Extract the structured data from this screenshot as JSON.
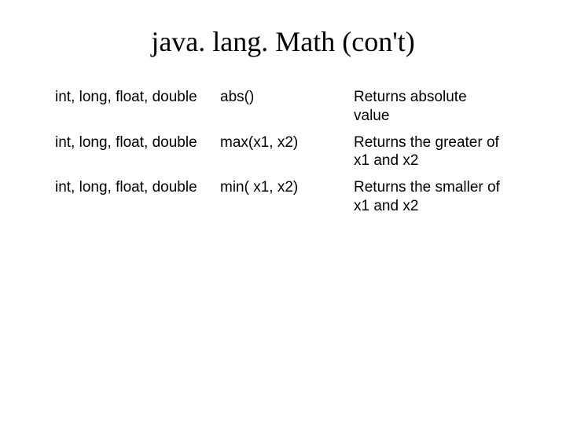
{
  "title": "java. lang. Math (con't)",
  "rows": [
    {
      "types": "int, long, float, double",
      "signature": "abs()",
      "description": "Returns absolute value"
    },
    {
      "types": "int, long, float, double",
      "signature": "max(x1, x2)",
      "description": "Returns the greater of x1 and x2"
    },
    {
      "types": "int, long, float, double",
      "signature": "min( x1, x2)",
      "description": "Returns the smaller of x1 and x2"
    }
  ]
}
